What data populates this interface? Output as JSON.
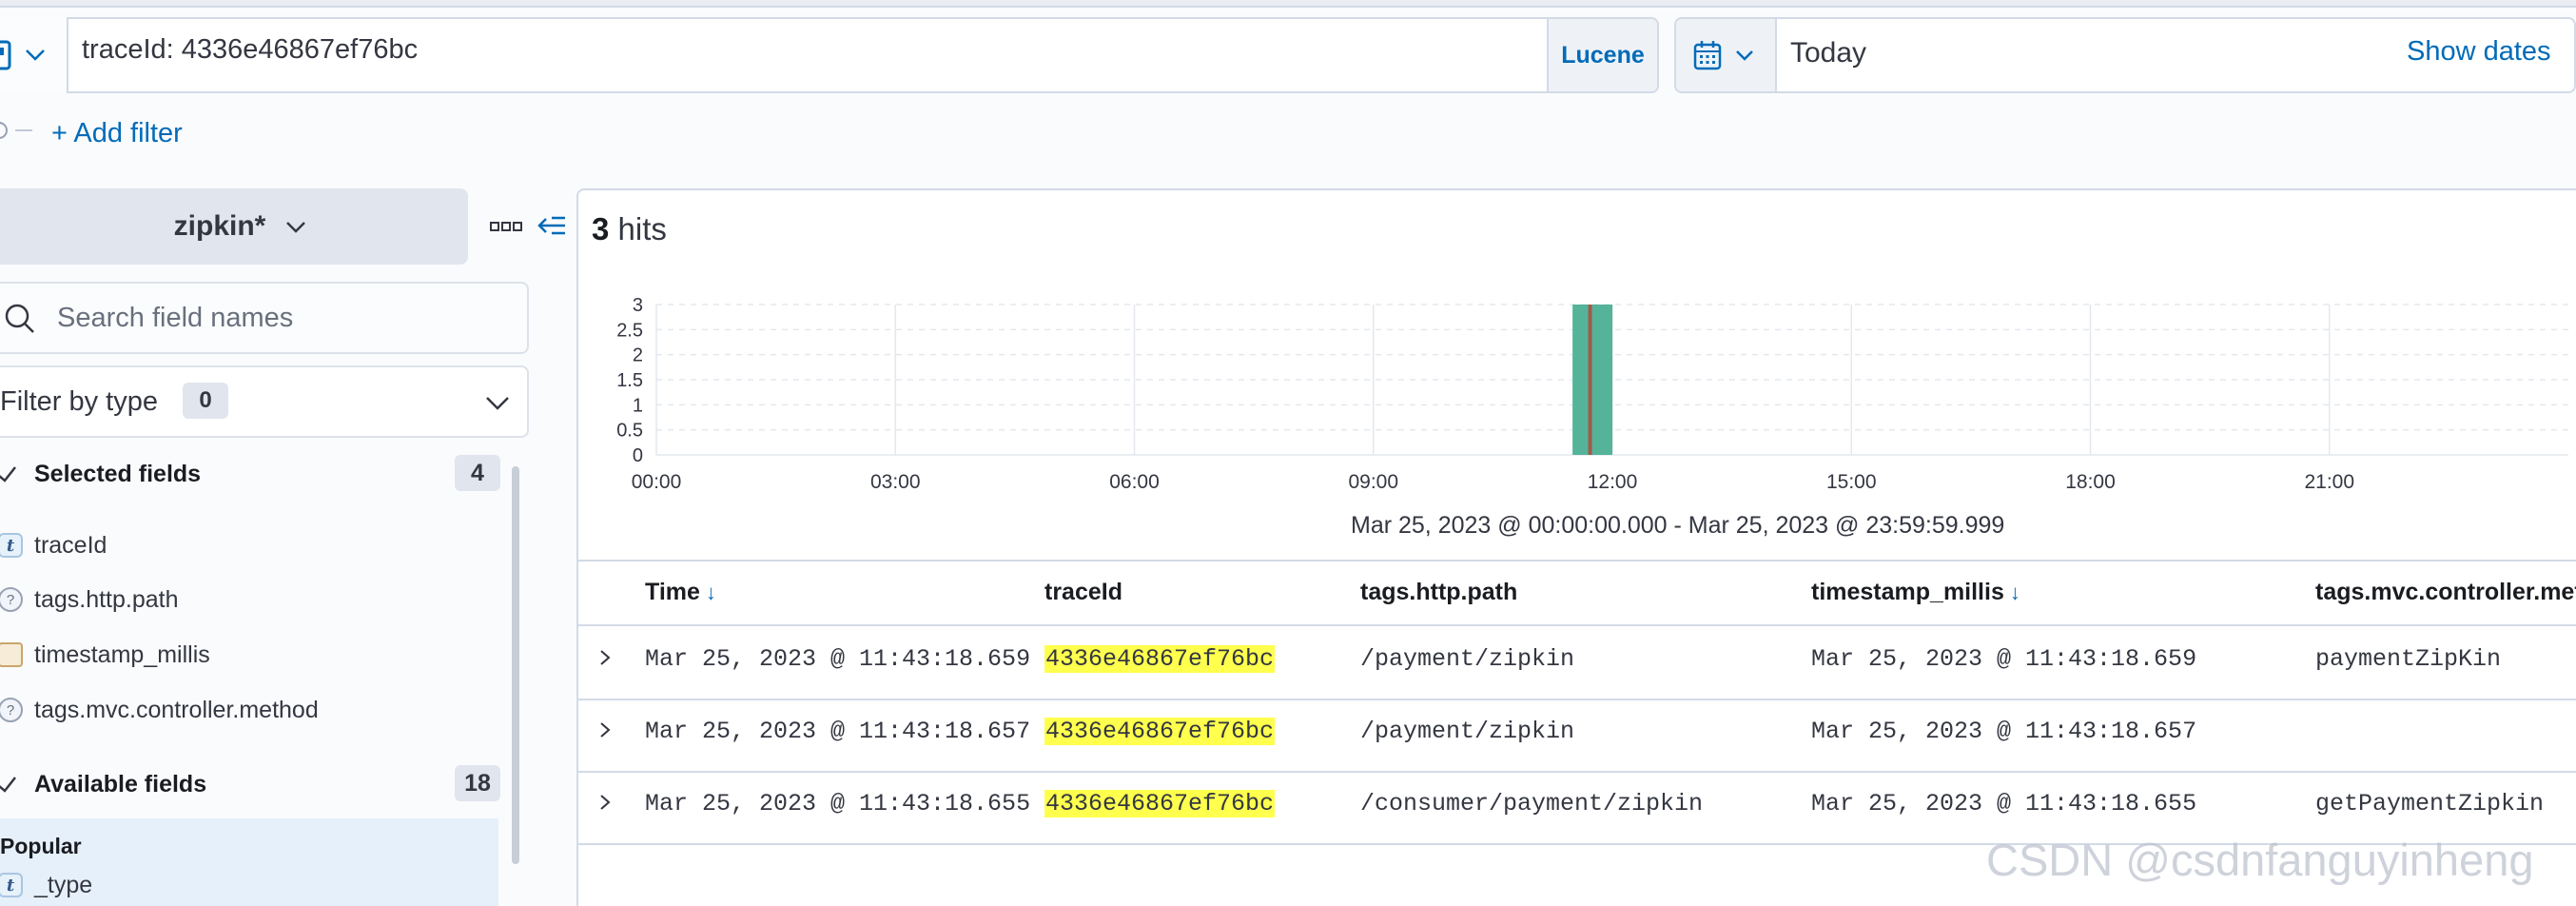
{
  "query": {
    "text": "traceId: 4336e46867ef76bc",
    "language": "Lucene"
  },
  "date_picker": {
    "value": "Today",
    "show_dates": "Show dates"
  },
  "filter": {
    "add_label": "+ Add filter"
  },
  "sidebar": {
    "index_pattern": "zipkin*",
    "search_placeholder": "Search field names",
    "filter_by_type": {
      "label": "Filter by type",
      "count": "0"
    },
    "selected": {
      "label": "Selected fields",
      "count": "4",
      "fields": [
        {
          "name": "traceId",
          "type": "t"
        },
        {
          "name": "tags.http.path",
          "type": "?"
        },
        {
          "name": "timestamp_millis",
          "type": "date"
        },
        {
          "name": "tags.mvc.controller.method",
          "type": "?"
        }
      ]
    },
    "available": {
      "label": "Available fields",
      "count": "18"
    },
    "popular": {
      "label": "Popular",
      "fields": [
        {
          "name": "_type",
          "type": "t"
        }
      ]
    }
  },
  "hits": {
    "count": "3",
    "label": "hits"
  },
  "chart_data": {
    "type": "bar",
    "x_ticks": [
      "00:00",
      "03:00",
      "06:00",
      "09:00",
      "12:00",
      "15:00",
      "18:00",
      "21:00"
    ],
    "y_ticks": [
      "0",
      "0.5",
      "1",
      "1.5",
      "2",
      "2.5",
      "3"
    ],
    "ylim": [
      0,
      3
    ],
    "xlim_hours": [
      0,
      24
    ],
    "bars": [
      {
        "start_hour": 11.5,
        "end_hour": 12.0,
        "value": 3
      }
    ],
    "current_time_hour": 11.72,
    "bar_color": "#54b399",
    "marker_color": "#a05a4a",
    "grid": true,
    "range_label": "Mar 25, 2023 @ 00:00:00.000 - Mar 25, 2023 @ 23:59:59.999"
  },
  "table": {
    "columns": [
      "Time",
      "traceId",
      "tags.http.path",
      "timestamp_millis",
      "tags.mvc.controller.met"
    ],
    "rows": [
      [
        "Mar 25, 2023 @ 11:43:18.659",
        "4336e46867ef76bc",
        "/payment/zipkin",
        "Mar 25, 2023 @ 11:43:18.659",
        "paymentZipKin"
      ],
      [
        "Mar 25, 2023 @ 11:43:18.657",
        "4336e46867ef76bc",
        "/payment/zipkin",
        "Mar 25, 2023 @ 11:43:18.657",
        ""
      ],
      [
        "Mar 25, 2023 @ 11:43:18.655",
        "4336e46867ef76bc",
        "/consumer/payment/zipkin",
        "Mar 25, 2023 @ 11:43:18.655",
        "getPaymentZipkin"
      ]
    ]
  },
  "colors": {
    "accent": "#006bb8",
    "highlight": "#ffff4d",
    "border": "#d3dae6"
  },
  "watermark": "CSDN @csdnfanguyinheng"
}
